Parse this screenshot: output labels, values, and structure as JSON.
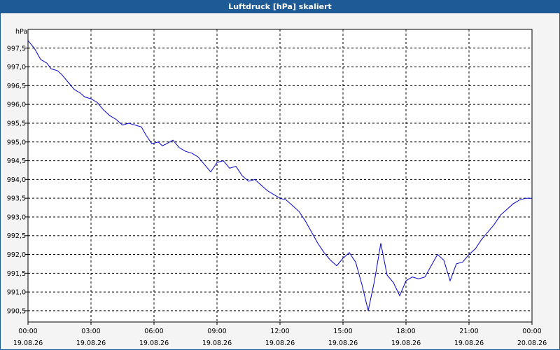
{
  "window": {
    "title": "Luftdruck [hPa] skaliert"
  },
  "chart_data": {
    "type": "line",
    "title": "Luftdruck [hPa] skaliert",
    "ylabel": "hPa",
    "xlabel": "",
    "xlim": [
      0,
      24
    ],
    "ylim": [
      990.2,
      998.0
    ],
    "grid": true,
    "line_color": "#0000cc",
    "y_ticks": [
      "997,5",
      "997,0",
      "996,5",
      "996,0",
      "995,5",
      "995,0",
      "994,5",
      "994,0",
      "993,5",
      "993,0",
      "992,5",
      "992,0",
      "991,5",
      "991,0",
      "990,5"
    ],
    "x_ticks": [
      {
        "time": "00:00",
        "date": "19.08.26"
      },
      {
        "time": "03:00",
        "date": "19.08.26"
      },
      {
        "time": "06:00",
        "date": "19.08.26"
      },
      {
        "time": "09:00",
        "date": "19.08.26"
      },
      {
        "time": "12:00",
        "date": "19.08.26"
      },
      {
        "time": "15:00",
        "date": "19.08.26"
      },
      {
        "time": "18:00",
        "date": "19.08.26"
      },
      {
        "time": "21:00",
        "date": "19.08.26"
      },
      {
        "time": "00:00",
        "date": "20.08.26"
      }
    ],
    "series": [
      {
        "x": [
          0,
          0.3,
          0.6,
          0.9,
          1.1,
          1.4,
          1.6,
          1.9,
          2.2,
          2.5,
          2.7,
          3.0,
          3.3,
          3.6,
          3.9,
          4.2,
          4.5,
          4.8,
          5.1,
          5.4,
          5.6,
          5.9,
          6.2,
          6.4,
          6.6,
          6.9,
          7.2,
          7.5,
          7.8,
          8.1,
          8.4,
          8.7,
          9.0,
          9.3,
          9.6,
          9.9,
          10.2,
          10.5,
          10.8,
          11.1,
          11.4,
          11.7,
          12.0,
          12.3,
          12.6,
          12.9,
          13.2,
          13.5,
          13.8,
          14.1,
          14.4,
          14.7,
          15.0,
          15.3,
          15.6,
          15.9,
          16.2,
          16.5,
          16.8,
          17.1,
          17.4,
          17.7,
          18.0,
          18.3,
          18.6,
          18.9,
          19.2,
          19.5,
          19.8,
          20.1,
          20.4,
          20.7,
          21.0,
          21.3,
          21.6,
          21.9,
          22.2,
          22.5,
          22.8,
          23.1,
          23.4,
          23.7,
          24.0
        ],
        "y": [
          997.7,
          997.5,
          997.2,
          997.1,
          996.95,
          996.9,
          996.8,
          996.6,
          996.4,
          996.3,
          996.2,
          996.15,
          996.05,
          995.85,
          995.7,
          995.6,
          995.45,
          995.5,
          995.45,
          995.4,
          995.2,
          994.95,
          995.0,
          994.9,
          994.95,
          995.05,
          994.85,
          994.75,
          994.7,
          994.6,
          994.4,
          994.2,
          994.45,
          994.5,
          994.3,
          994.35,
          994.1,
          993.95,
          994.0,
          993.85,
          993.7,
          993.6,
          993.5,
          993.45,
          993.3,
          993.15,
          992.9,
          992.6,
          992.3,
          992.05,
          991.85,
          991.7,
          991.9,
          992.05,
          991.8,
          991.2,
          990.5,
          991.3,
          992.3,
          991.45,
          991.25,
          990.9,
          991.3,
          991.4,
          991.35,
          991.4,
          991.7,
          992.0,
          991.85,
          991.3,
          991.75,
          991.8,
          992.0,
          992.15,
          992.4,
          992.6,
          992.8,
          993.05,
          993.2,
          993.35,
          993.45,
          993.5,
          993.5
        ]
      }
    ]
  }
}
